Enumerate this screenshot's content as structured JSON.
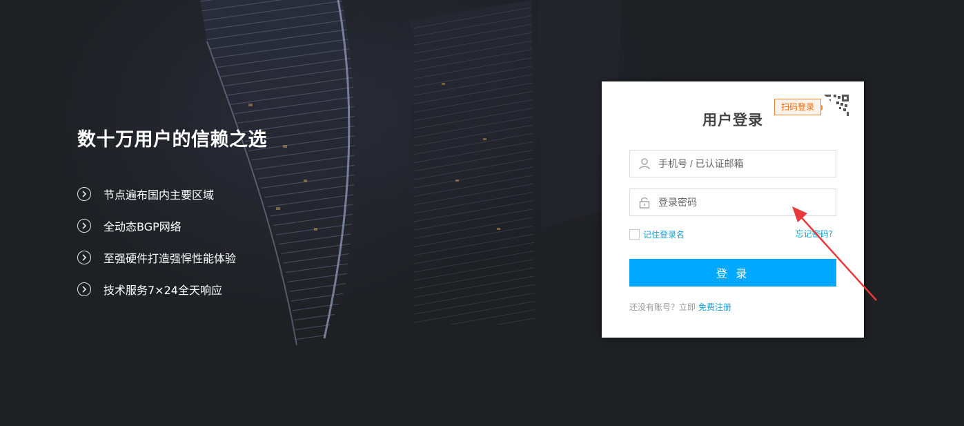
{
  "hero": {
    "title": "数十万用户的信赖之选",
    "features": [
      {
        "label": "节点遍布国内主要区域",
        "icon": "chevron-right-circle-icon"
      },
      {
        "label": "全动态BGP网络",
        "icon": "chevron-right-circle-icon"
      },
      {
        "label": "至强硬件打造强悍性能体验",
        "icon": "chevron-right-circle-icon"
      },
      {
        "label": "技术服务7×24全天响应",
        "icon": "chevron-right-circle-icon"
      }
    ]
  },
  "login": {
    "title": "用户登录",
    "qr_tip": "扫码登录",
    "qr_icon": "qr-code-icon",
    "username": {
      "placeholder": "手机号 / 已认证邮箱",
      "value": "",
      "icon": "user-icon"
    },
    "password": {
      "placeholder": "登录密码",
      "value": "",
      "icon": "lock-icon"
    },
    "remember_label": "记住登录名",
    "remember_checked": false,
    "forgot_label": "忘记密码?",
    "submit_label": "登 录",
    "register_prompt": "还没有账号？立即",
    "register_link": "免费注册"
  },
  "colors": {
    "background": "#1f2024",
    "primary_button": "#00a8ff",
    "link": "#17a0d8",
    "qr_tip_border": "#f08a3a",
    "annotation_arrow": "#e83a3a"
  }
}
